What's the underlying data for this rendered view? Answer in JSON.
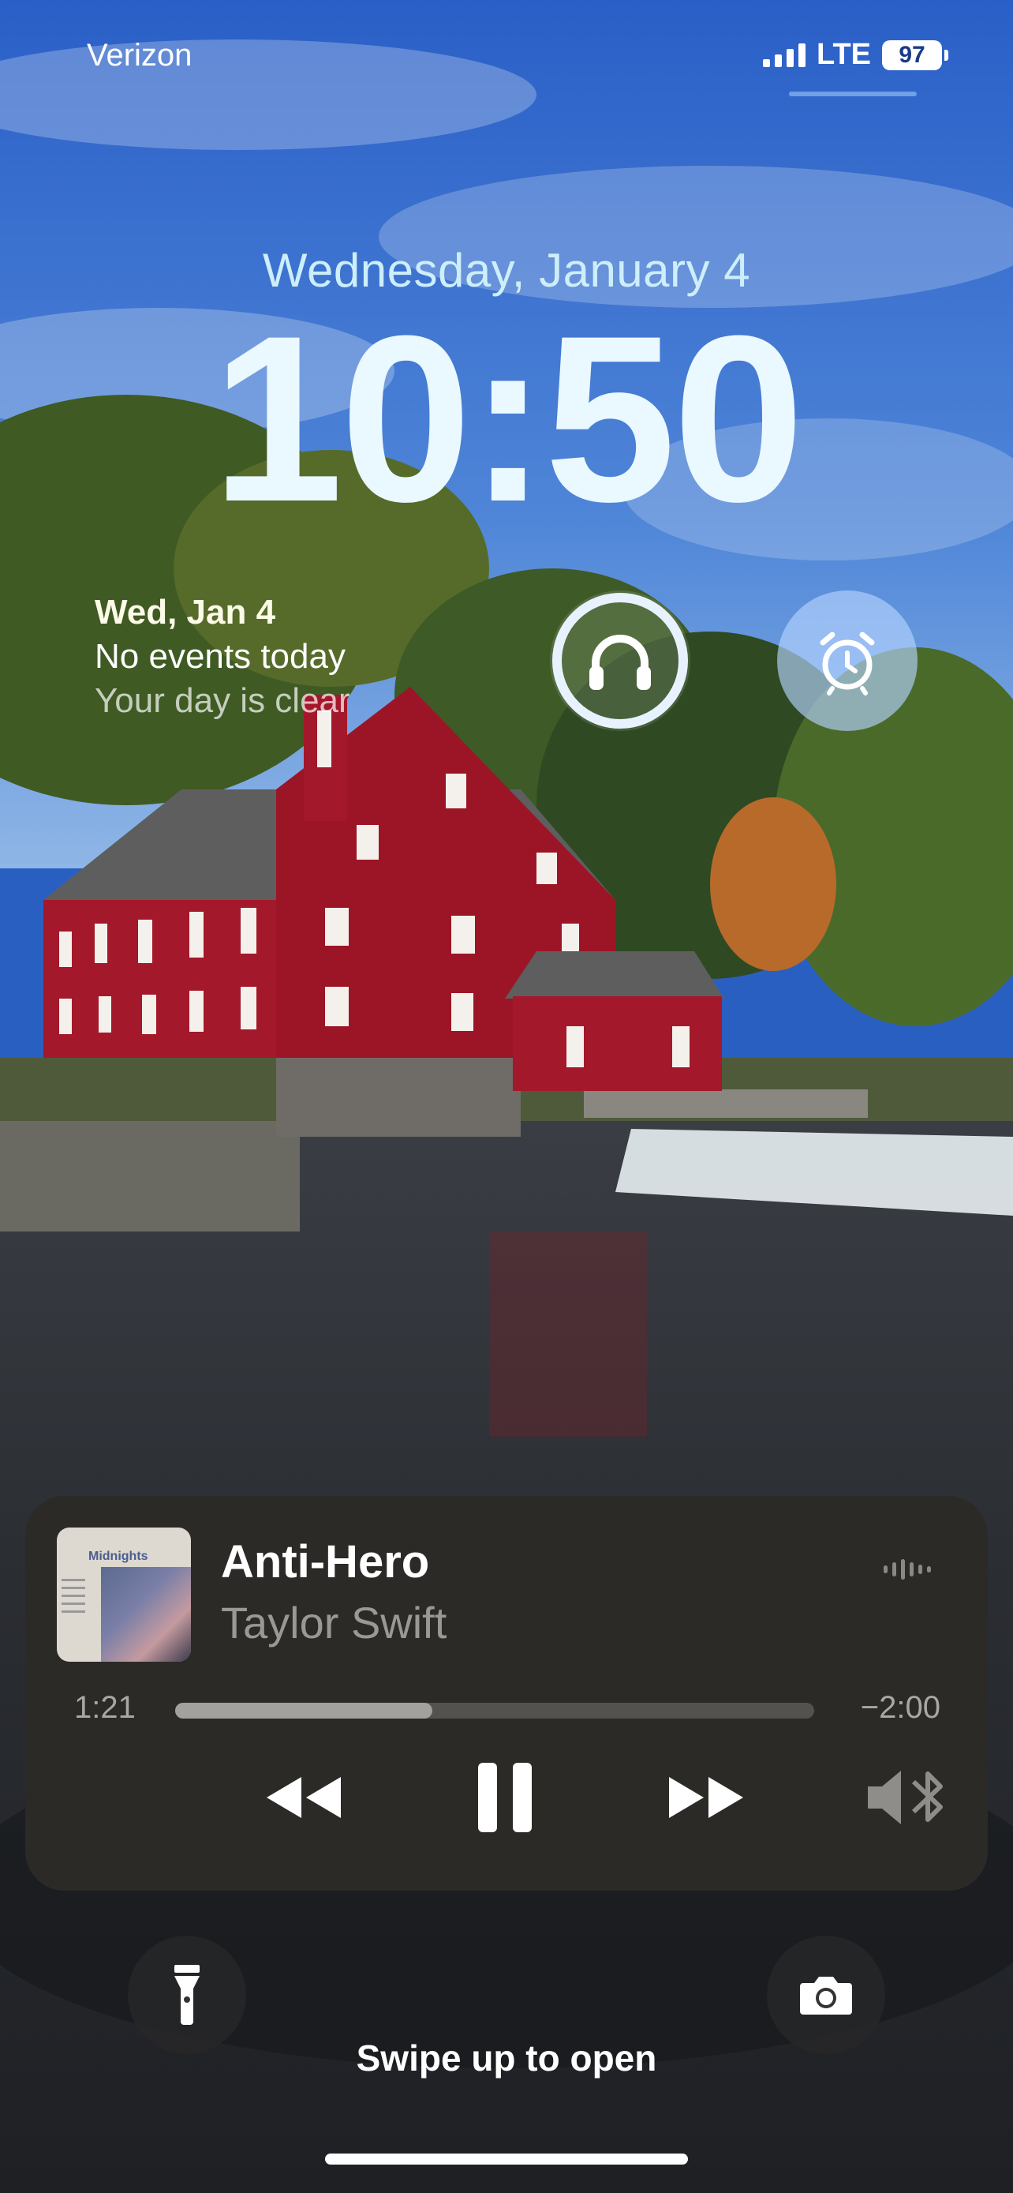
{
  "status_bar": {
    "carrier": "Verizon",
    "network": "LTE",
    "battery": "97"
  },
  "lock_screen": {
    "date": "Wednesday, January 4",
    "time": "10:50"
  },
  "calendar_widget": {
    "date": "Wed, Jan 4",
    "line1": "No events today",
    "line2": "Your day is clear"
  },
  "widgets": {
    "audio_icon": "headphones-icon",
    "alarm_icon": "alarm-clock-icon"
  },
  "now_playing": {
    "album_label": "Midnights",
    "title": "Anti-Hero",
    "artist": "Taylor Swift",
    "elapsed": "1:21",
    "remaining": "−2:00",
    "progress": 0.403
  },
  "bottom": {
    "swipe_hint": "Swipe up to open",
    "left_button_icon": "flashlight-icon",
    "right_button_icon": "camera-icon"
  },
  "colors": {
    "sky": "#2a5fc2",
    "player_bg": "#2c2a27",
    "mill_red": "#a3182a"
  }
}
